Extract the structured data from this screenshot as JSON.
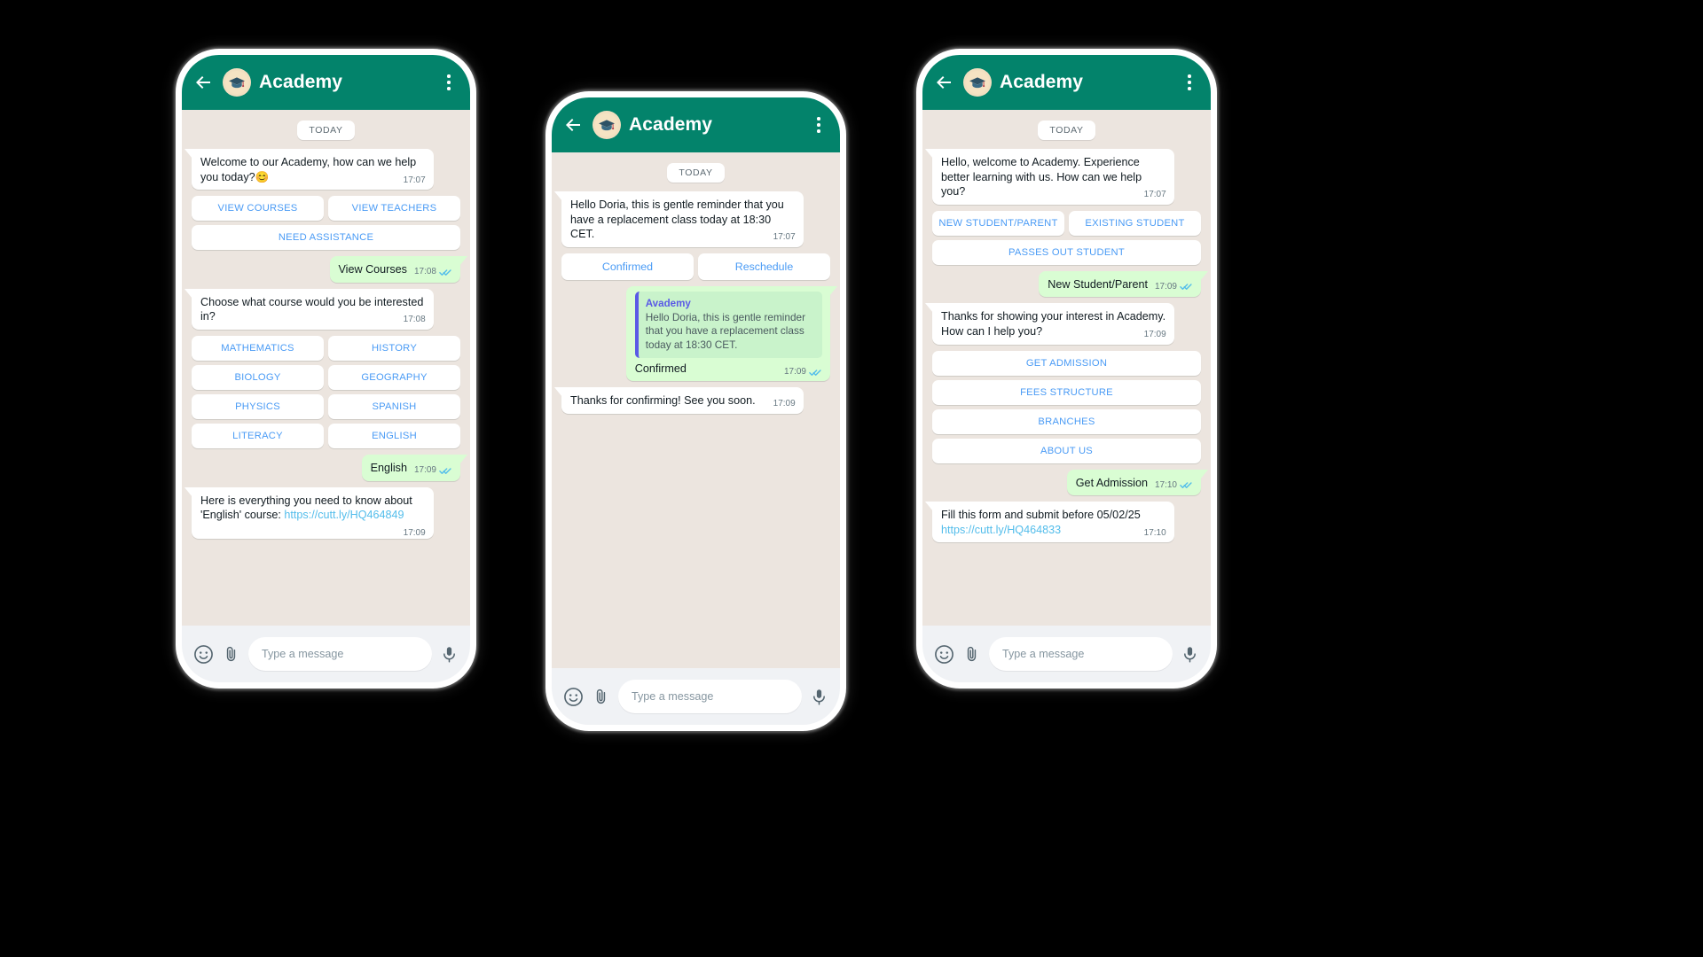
{
  "header": {
    "title": "Academy",
    "back_icon": "back-arrow-icon",
    "avatar_icon": "graduation-cap-avatar",
    "menu_icon": "kebab-menu-icon",
    "bg_color": "#03836b"
  },
  "composer": {
    "placeholder": "Type a message",
    "emoji_icon": "emoji-smiley-icon",
    "attach_icon": "paperclip-icon",
    "mic_icon": "microphone-icon"
  },
  "colors": {
    "header_green": "#03836b",
    "chat_bg": "#ece5df",
    "out_bubble": "#d9fdd3",
    "in_bubble": "#ffffff",
    "button_blue": "#4a9bf5",
    "link_blue": "#53bdeb",
    "tick_blue": "#53bdeb",
    "quote_accent": "#5a5ae6"
  },
  "phone1": {
    "day_divider": "TODAY",
    "messages": [
      {
        "kind": "in",
        "text": "Welcome to our Academy, how can we help you today?😊",
        "time": "17:07"
      },
      {
        "kind": "buttons",
        "items": [
          "VIEW COURSES",
          "VIEW TEACHERS",
          "NEED ASSISTANCE"
        ],
        "fullwidth_index": 2
      },
      {
        "kind": "out",
        "text": "View Courses",
        "time": "17:08",
        "ticks": "double-check-blue"
      },
      {
        "kind": "in",
        "text": "Choose what course would you be interested in?",
        "time": "17:08"
      },
      {
        "kind": "buttons",
        "items": [
          "MATHEMATICS",
          "HISTORY",
          "BIOLOGY",
          "GEOGRAPHY",
          "PHYSICS",
          "SPANISH",
          "LITERACY",
          "ENGLISH"
        ]
      },
      {
        "kind": "out",
        "text": "English",
        "time": "17:09",
        "ticks": "double-check-blue"
      },
      {
        "kind": "in_link",
        "text": "Here is everything you need to know about 'English' course: ",
        "link": "https://cutt.ly/HQ464849",
        "time": "17:09"
      }
    ]
  },
  "phone2": {
    "day_divider": "TODAY",
    "messages": [
      {
        "kind": "in",
        "text": "Hello Doria, this is gentle reminder that you have a replacement class today at 18:30 CET.",
        "time": "17:07"
      },
      {
        "kind": "buttons",
        "items": [
          "Confirmed",
          "Reschedule"
        ],
        "style": "mixed"
      },
      {
        "kind": "out_quote",
        "quote_name": "Avademy",
        "quote_text": "Hello Doria, this is gentle reminder that you have a replacement class today at 18:30 CET.",
        "text": "Confirmed",
        "time": "17:09",
        "ticks": "double-check-blue"
      },
      {
        "kind": "in",
        "text": "Thanks for confirming! See you soon.",
        "time": "17:09"
      }
    ]
  },
  "phone3": {
    "day_divider": "TODAY",
    "messages": [
      {
        "kind": "in",
        "text": "Hello, welcome to Academy. Experience better learning with us. How can we help you?",
        "time": "17:07"
      },
      {
        "kind": "buttons",
        "items": [
          "NEW STUDENT/PARENT",
          "EXISTING STUDENT",
          "PASSES OUT STUDENT"
        ],
        "fullwidth_index": 2
      },
      {
        "kind": "out",
        "text": "New Student/Parent",
        "time": "17:09",
        "ticks": "double-check-blue"
      },
      {
        "kind": "in",
        "text": "Thanks for showing your interest in Academy. How can I help you?",
        "time": "17:09"
      },
      {
        "kind": "buttons",
        "items": [
          "GET ADMISSION",
          "FEES STRUCTURE",
          "BRANCHES",
          "ABOUT US"
        ],
        "stacked": true
      },
      {
        "kind": "out",
        "text": "Get Admission",
        "time": "17:10",
        "ticks": "double-check-blue"
      },
      {
        "kind": "in_link",
        "text": "Fill this form and submit before 05/02/25 ",
        "link": "https://cutt.ly/HQ464833",
        "time": "17:10"
      }
    ]
  }
}
